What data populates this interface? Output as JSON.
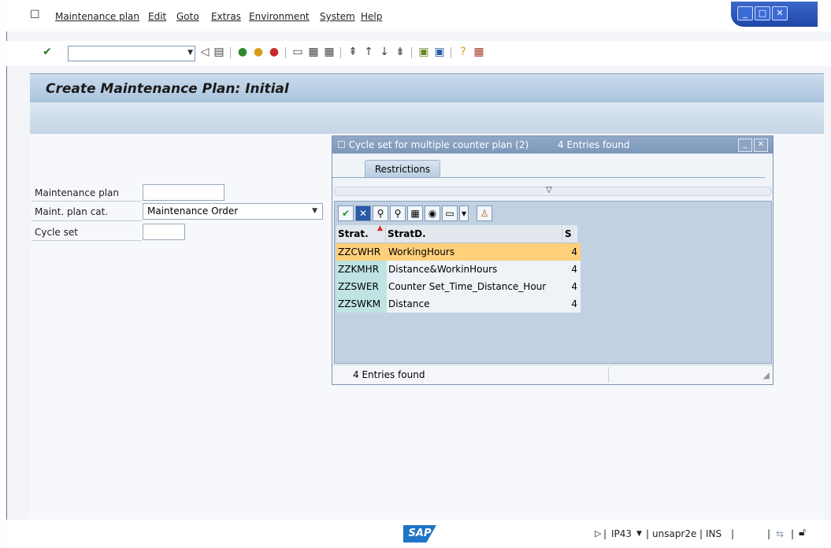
{
  "menubar": {
    "items": [
      "Maintenance plan",
      "Edit",
      "Goto",
      "Extras",
      "Environment",
      "System",
      "Help"
    ]
  },
  "toolbar": {
    "command_value": ""
  },
  "window": {
    "title": "Create Maintenance Plan: Initial"
  },
  "form": {
    "maintenance_plan_label": "Maintenance plan",
    "maintenance_plan_value": "",
    "plan_cat_label": "Maint. plan cat.",
    "plan_cat_value": "Maintenance Order",
    "cycle_set_label": "Cycle set",
    "cycle_set_value": ""
  },
  "dialog": {
    "title": "Cycle set for multiple counter plan (2)",
    "count": "4 Entries found",
    "tab_label": "Restrictions",
    "columns": [
      "Strat.",
      "StratD.",
      "S"
    ],
    "rows": [
      {
        "strat": "ZZCWHR",
        "desc": "WorkingHours",
        "s": "4"
      },
      {
        "strat": "ZZKMHR",
        "desc": "Distance&WorkinHours",
        "s": "4"
      },
      {
        "strat": "ZZSWER",
        "desc": "Counter Set_Time_Distance_Hour",
        "s": "4"
      },
      {
        "strat": "ZZSWKM",
        "desc": "Distance",
        "s": "4"
      }
    ],
    "status_text": "4 Entries found"
  },
  "statusbar": {
    "sap_logo": "SAP",
    "transaction": "IP43",
    "server": "unsapr2e",
    "mode": "INS"
  },
  "colors": {
    "title_gradient": "#a9c3dc",
    "selected_row": "#ffcf7a",
    "key_cell": "#bfe3e3"
  }
}
